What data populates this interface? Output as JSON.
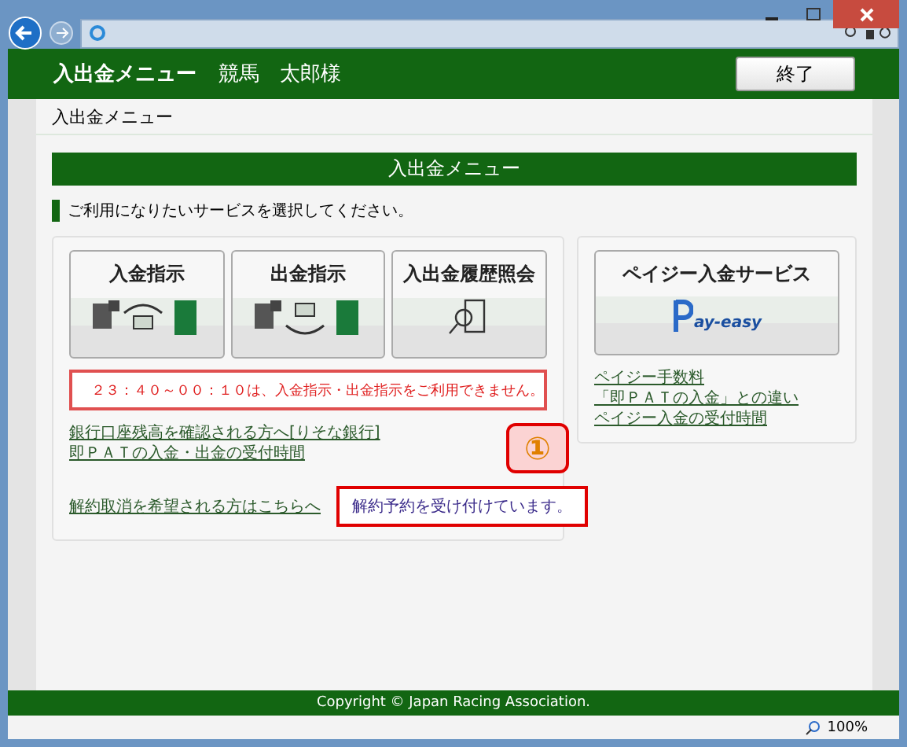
{
  "browser": {
    "zoom": "100%"
  },
  "header": {
    "title": "入出金メニュー",
    "user": "競馬　太郎様",
    "exit_button": "終了"
  },
  "breadcrumb": "入出金メニュー",
  "section_title": "入出金メニュー",
  "instruction": "ご利用になりたいサービスを選択してください。",
  "menu_buttons": [
    {
      "label": "入金指示",
      "kind": "deposit"
    },
    {
      "label": "出金指示",
      "kind": "withdraw"
    },
    {
      "label": "入出金履歴照会",
      "kind": "history"
    }
  ],
  "notice": "２３：４０～００：１０は、入金指示・出金指示をご利用できません。",
  "links": [
    "銀行口座残高を確認される方へ[りそな銀行]",
    "即ＰＡＴの入金・出金の受付時間"
  ],
  "cancel_link": "解約取消を希望される方はこちらへ",
  "cancel_status": "解約予約を受け付けています。",
  "callout": "①",
  "payeasy": {
    "button": "ペイジー入金サービス",
    "logo": "ay-easy",
    "links": [
      "ペイジー手数料",
      "「即ＰＡＴの入金」との違い",
      "ペイジー入金の受付時間"
    ]
  },
  "footer": "Copyright © Japan Racing Association."
}
